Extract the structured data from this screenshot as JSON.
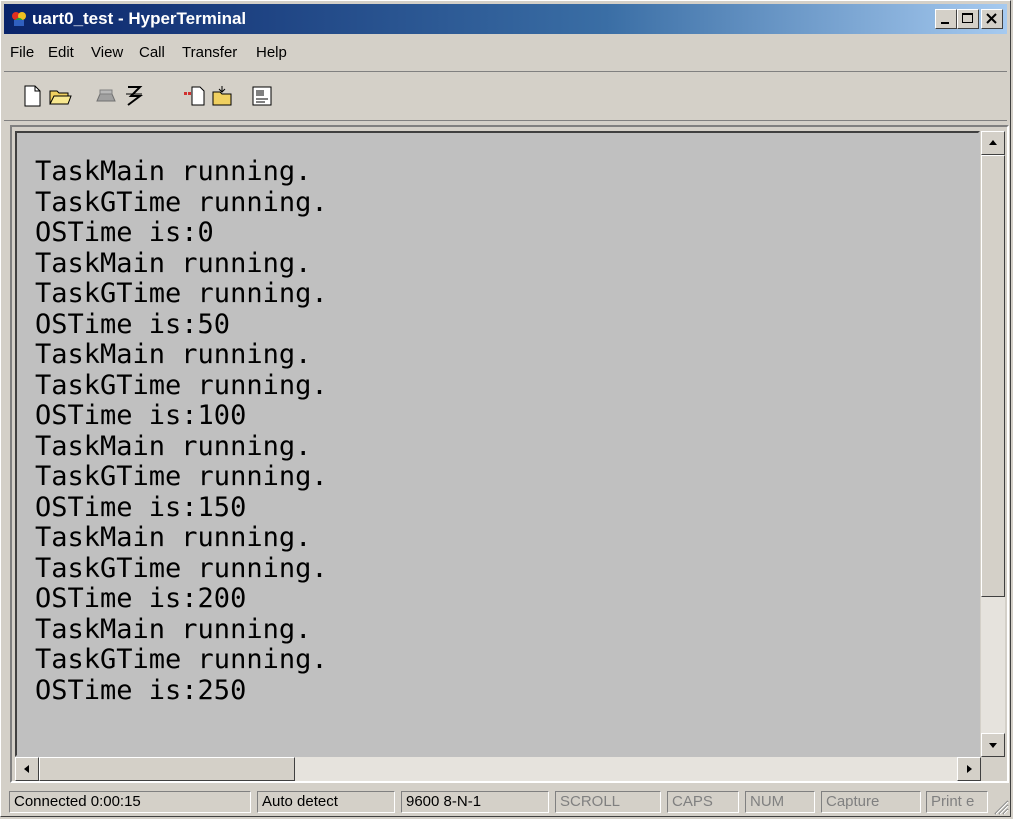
{
  "window": {
    "title": "uart0_test - HyperTerminal",
    "app_icon": "hyperterminal-icon",
    "controls": [
      "minimize",
      "maximize",
      "close"
    ]
  },
  "menu": {
    "items": [
      "File",
      "Edit",
      "View",
      "Call",
      "Transfer",
      "Help"
    ]
  },
  "toolbar": {
    "buttons": [
      "new-icon",
      "open-icon",
      "disconnect-icon",
      "dial-icon",
      "send-icon",
      "receive-icon",
      "properties-icon"
    ]
  },
  "terminal": {
    "background": "#c0c0c0",
    "lines": [
      "TaskMain running.",
      "TaskGTime running.",
      "OSTime is:0",
      "TaskMain running.",
      "TaskGTime running.",
      "OSTime is:50",
      "TaskMain running.",
      "TaskGTime running.",
      "OSTime is:100",
      "TaskMain running.",
      "TaskGTime running.",
      "OSTime is:150",
      "TaskMain running.",
      "TaskGTime running.",
      "OSTime is:200",
      "TaskMain running.",
      "TaskGTime running.",
      "OSTime is:250"
    ]
  },
  "statusbar": {
    "connection": "Connected 0:00:15",
    "emulation": "Auto detect",
    "settings": "9600 8-N-1",
    "scroll": "SCROLL",
    "caps": "CAPS",
    "num": "NUM",
    "capture": "Capture",
    "print": "Print e"
  }
}
